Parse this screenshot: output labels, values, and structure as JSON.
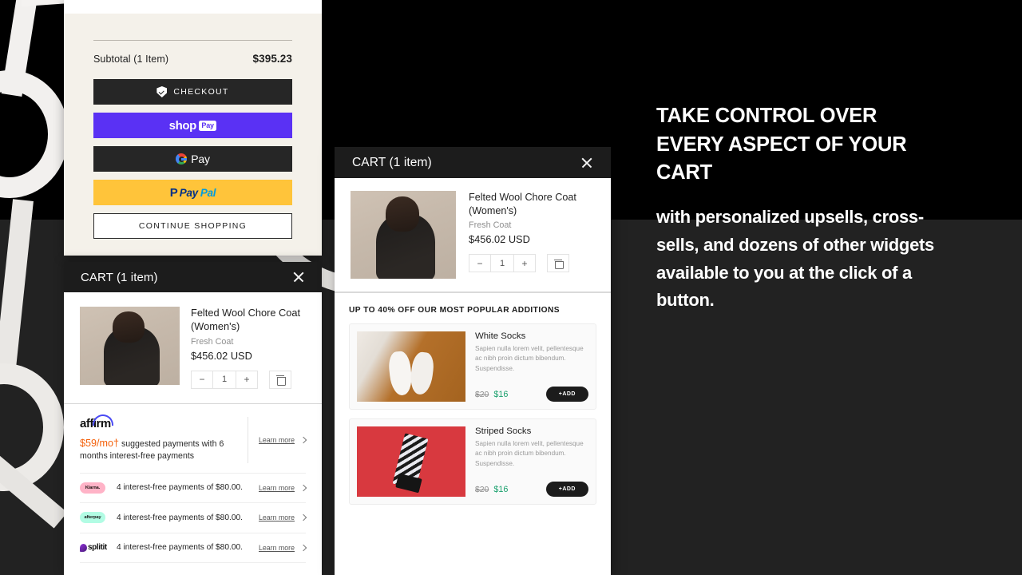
{
  "summary_panel": {
    "subtotal_label": "Subtotal (1 Item)",
    "subtotal_value": "$395.23",
    "checkout_label": "CHECKOUT",
    "checkout_icon": "shield-check-icon",
    "shop_pay": {
      "word": "shop",
      "chip": "Pay"
    },
    "google_pay": {
      "logo": "google-g-icon",
      "word": "Pay"
    },
    "paypal": {
      "glyph": "P",
      "part_a": "Pay",
      "part_b": "Pal"
    },
    "continue_label": "CONTINUE SHOPPING"
  },
  "cart_left": {
    "title": "CART (1 item)",
    "close_icon": "close-icon",
    "item": {
      "title": "Felted Wool Chore Coat (Women's)",
      "variant": "Fresh Coat",
      "price": "$456.02 USD",
      "qty": "1",
      "minus": "−",
      "plus": "+",
      "remove_icon": "trash-icon"
    },
    "financing": {
      "affirm": {
        "brand": "affirm",
        "amount": "$59/mo†",
        "copy": " suggested payments with 6 months interest-free payments",
        "learn_more": "Learn more"
      },
      "rows": [
        {
          "brand": "Klarna.",
          "text": "4 interest-free payments of $80.00.",
          "learn_more": "Learn more"
        },
        {
          "brand": "afterpay",
          "text": "4 interest-free payments of $80.00.",
          "learn_more": "Learn more"
        },
        {
          "brand": "splitit",
          "text": "4 interest-free payments of $80.00.",
          "learn_more": "Learn more"
        }
      ]
    }
  },
  "cart_mid": {
    "title": "CART (1 item)",
    "close_icon": "close-icon",
    "item": {
      "title": "Felted Wool Chore Coat (Women's)",
      "variant": "Fresh Coat",
      "price": "$456.02 USD",
      "qty": "1",
      "minus": "−",
      "plus": "+",
      "remove_icon": "trash-icon"
    },
    "upsell_heading": "UP TO 40% OFF OUR MOST POPULAR ADDITIONS",
    "upsells": [
      {
        "name": "White Socks",
        "desc": "Sapien nulla lorem velit, pellentesque ac nibh proin dictum bibendum. Suspendisse.",
        "price_was": "$20",
        "price_now": "$16",
        "add_label": "+ADD"
      },
      {
        "name": "Striped Socks",
        "desc": "Sapien nulla lorem velit, pellentesque ac nibh proin dictum bibendum. Suspendisse.",
        "price_was": "$20",
        "price_now": "$16",
        "add_label": "+ADD"
      }
    ]
  },
  "marketing": {
    "headline": "TAKE CONTROL OVER EVERY ASPECT OF YOUR CART",
    "subline": "with personalized upsells, cross-sells, and dozens of other widgets available to you at the click of a button."
  },
  "colors": {
    "bg_top": "#000000",
    "bg_bottom": "#222222",
    "panel_cream": "#f4f1ea",
    "dark_button": "#262626",
    "shop_pay_purple": "#5a31f4",
    "paypal_yellow": "#ffc43a",
    "affirm_orange": "#f4600a",
    "sale_green": "#1aa06d",
    "klarna_pink": "#ffb3c7",
    "afterpay_mint": "#b2fce4"
  }
}
